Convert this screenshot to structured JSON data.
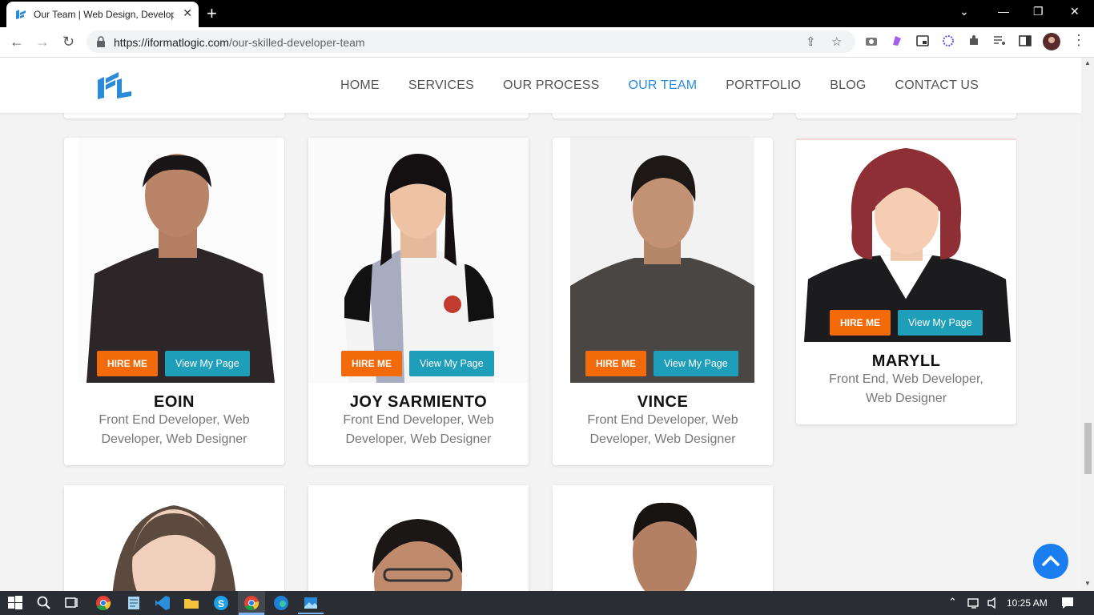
{
  "browser": {
    "tab_title": "Our Team | Web Design, Develop",
    "url_host": "https://iformatlogic.com",
    "url_path": "/our-skilled-developer-team"
  },
  "site": {
    "nav": [
      {
        "label": "HOME",
        "active": false
      },
      {
        "label": "SERVICES",
        "active": false
      },
      {
        "label": "OUR PROCESS",
        "active": false
      },
      {
        "label": "OUR TEAM",
        "active": true
      },
      {
        "label": "PORTFOLIO",
        "active": false
      },
      {
        "label": "BLOG",
        "active": false
      },
      {
        "label": "CONTACT US",
        "active": false
      }
    ],
    "accent": "#2a8bd8",
    "hire_color": "#f26a0a",
    "view_color": "#1e9eb8"
  },
  "team": [
    {
      "name": "EOIN",
      "role": "Front End Developer, Web Developer, Web Designer",
      "hire": "HIRE ME",
      "view": "View My Page"
    },
    {
      "name": "JOY SARMIENTO",
      "role": "Front End Developer, Web Developer, Web Designer",
      "hire": "HIRE ME",
      "view": "View My Page"
    },
    {
      "name": "VINCE",
      "role": "Front End Developer, Web Developer, Web Designer",
      "hire": "HIRE ME",
      "view": "View My Page"
    },
    {
      "name": "MARYLL",
      "role": "Front End, Web Developer, Web Designer",
      "hire": "HIRE ME",
      "view": "View My Page"
    }
  ],
  "taskbar": {
    "clock": "10:25 AM"
  }
}
